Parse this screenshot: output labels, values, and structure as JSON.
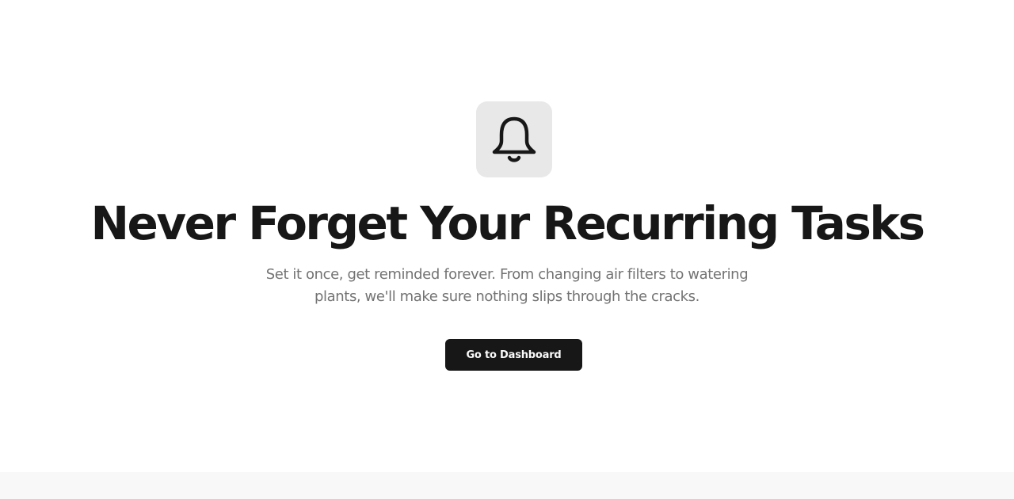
{
  "hero": {
    "icon": "bell-icon",
    "title": "Never Forget Your Recurring Tasks",
    "subtitle": "Set it once, get reminded forever. From changing air filters to watering plants, we'll make sure nothing slips through the cracks.",
    "cta_label": "Go to Dashboard"
  },
  "colors": {
    "background": "#ffffff",
    "icon_tile": "#e8e8e8",
    "text_primary": "#171717",
    "text_muted": "#737373",
    "button_bg": "#171717",
    "button_text": "#fafafa",
    "footer_band": "#f8f8f8"
  }
}
